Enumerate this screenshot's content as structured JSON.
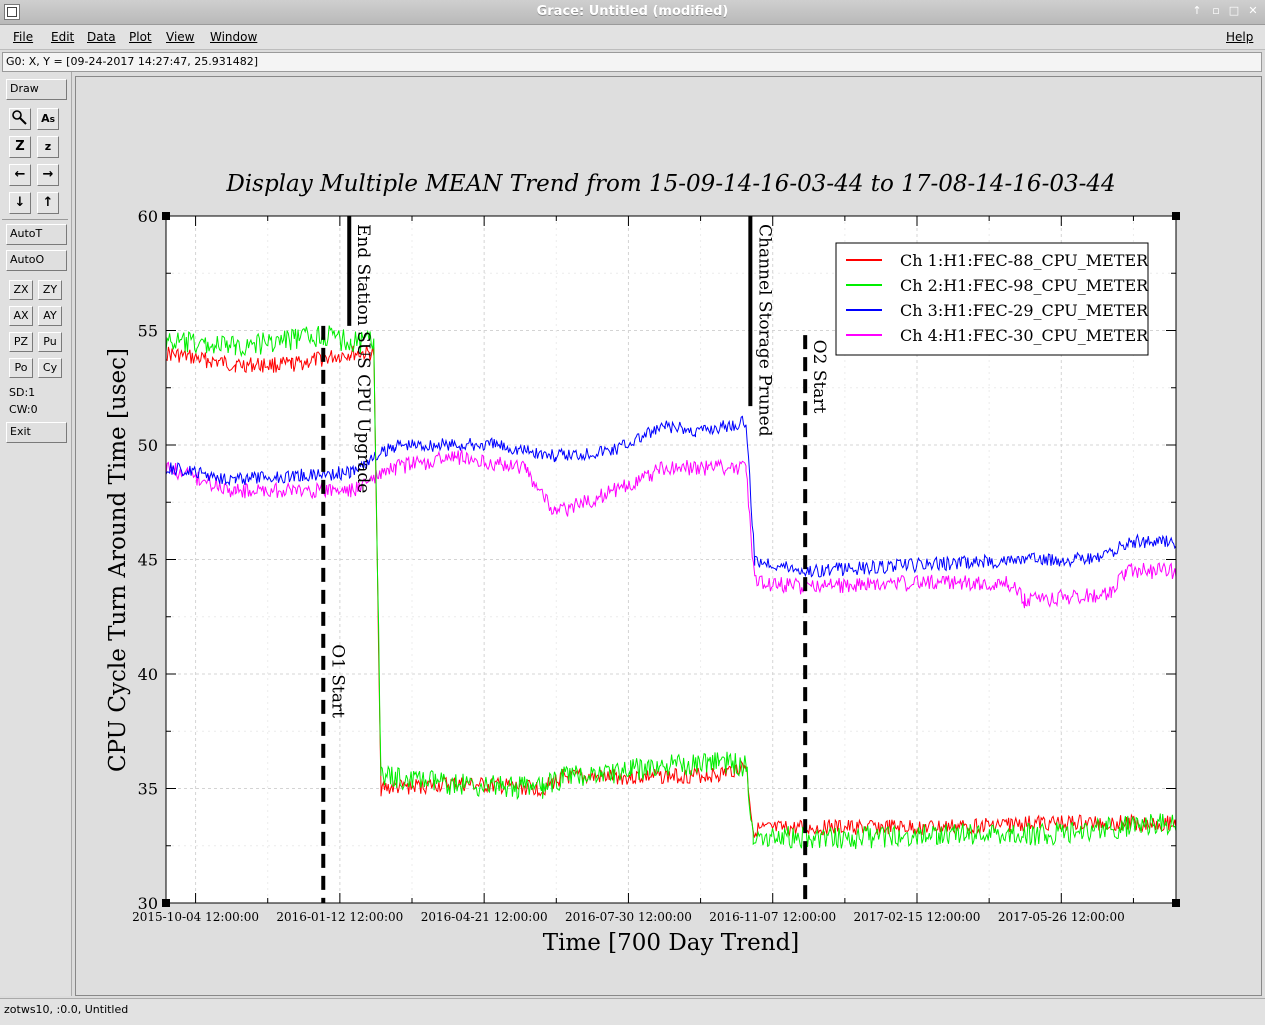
{
  "window": {
    "title": "Grace: Untitled (modified)"
  },
  "menubar": {
    "items": [
      "File",
      "Edit",
      "Data",
      "Plot",
      "View",
      "Window"
    ],
    "help": "Help"
  },
  "locator": {
    "text": "G0: X, Y = [09-24-2017 14:27:47, 25.931482]"
  },
  "tools": {
    "draw": "Draw",
    "autot": "AutoT",
    "autoo": "AutoO",
    "small_buttons": [
      "ZX",
      "ZY",
      "AX",
      "AY",
      "PZ",
      "Pu",
      "Po",
      "Cy"
    ],
    "sd": "SD:1",
    "cw": "CW:0",
    "exit": "Exit"
  },
  "status": {
    "text": "zotws10, :0.0, Untitled"
  },
  "colors": {
    "ch1": "#ff0000",
    "ch2": "#00ee00",
    "ch3": "#0000ff",
    "ch4": "#ff00ff"
  },
  "chart_data": {
    "type": "line",
    "title": "Display Multiple MEAN Trend from 15-09-14-16-03-44 to 17-08-14-16-03-44",
    "xlabel": "Time [700 Day Trend]",
    "ylabel": "CPU Cycle Turn Around Time [usec]",
    "ylim": [
      30,
      60
    ],
    "xlim": [
      "2015-09-14",
      "2017-08-14"
    ],
    "yticks": [
      30,
      35,
      40,
      45,
      50,
      55,
      60
    ],
    "xtick_labels": [
      "2015-10-04 12:00:00",
      "2016-01-12 12:00:00",
      "2016-04-21 12:00:00",
      "2016-07-30 12:00:00",
      "2016-11-07 12:00:00",
      "2017-02-15 12:00:00",
      "2017-05-26 12:00:00"
    ],
    "grid": true,
    "legend_position": "top-right",
    "series": [
      {
        "name": "Ch 1:H1:FEC-88_CPU_METER",
        "x": [
          "2015-09-14",
          "2015-11-01",
          "2015-12-10",
          "2016-01-20",
          "2016-02-05",
          "2016-02-10",
          "2016-04-01",
          "2016-06-01",
          "2016-06-15",
          "2016-08-01",
          "2016-10-01",
          "2016-10-20",
          "2016-10-25",
          "2016-12-15",
          "2017-03-01",
          "2017-05-15",
          "2017-08-14"
        ],
        "values": [
          54.0,
          53.5,
          53.5,
          54.0,
          54.0,
          35.0,
          35.2,
          35.0,
          35.5,
          35.5,
          35.6,
          36.0,
          33.2,
          33.3,
          33.3,
          33.5,
          33.5
        ]
      },
      {
        "name": "Ch 2:H1:FEC-98_CPU_METER",
        "x": [
          "2015-09-14",
          "2015-11-01",
          "2016-01-01",
          "2016-01-20",
          "2016-02-05",
          "2016-02-10",
          "2016-04-01",
          "2016-06-01",
          "2016-06-15",
          "2016-08-01",
          "2016-10-01",
          "2016-10-20",
          "2016-10-25",
          "2016-12-15",
          "2017-03-01",
          "2017-05-15",
          "2017-08-14"
        ],
        "values": [
          54.5,
          54.3,
          54.8,
          54.5,
          54.5,
          35.5,
          35.2,
          35.0,
          35.5,
          35.8,
          36.2,
          36.0,
          33.0,
          32.8,
          33.0,
          33.0,
          33.5
        ]
      },
      {
        "name": "Ch 3:H1:FEC-29_CPU_METER",
        "x": [
          "2015-09-14",
          "2015-11-01",
          "2016-01-20",
          "2016-02-20",
          "2016-05-01",
          "2016-06-10",
          "2016-07-20",
          "2016-08-25",
          "2016-09-15",
          "2016-10-20",
          "2016-10-26",
          "2016-12-01",
          "2017-03-01",
          "2017-05-01",
          "2017-05-26",
          "2017-06-20",
          "2017-07-15",
          "2017-08-14"
        ],
        "values": [
          49.0,
          48.5,
          48.8,
          50.0,
          50.0,
          49.5,
          49.8,
          50.8,
          50.6,
          51.0,
          45.0,
          44.5,
          44.8,
          45.0,
          45.0,
          45.0,
          45.8,
          45.8
        ]
      },
      {
        "name": "Ch 4:H1:FEC-30_CPU_METER",
        "x": [
          "2015-09-14",
          "2015-11-01",
          "2016-01-20",
          "2016-02-20",
          "2016-04-01",
          "2016-05-20",
          "2016-06-10",
          "2016-07-20",
          "2016-08-25",
          "2016-10-20",
          "2016-10-26",
          "2016-12-01",
          "2017-03-01",
          "2017-04-20",
          "2017-05-01",
          "2017-06-30",
          "2017-07-10",
          "2017-08-14"
        ],
        "values": [
          49.0,
          48.0,
          48.0,
          49.0,
          49.5,
          49.0,
          47.0,
          48.0,
          49.0,
          49.0,
          44.0,
          43.8,
          44.0,
          44.0,
          43.2,
          43.5,
          44.5,
          44.5
        ]
      }
    ],
    "events": [
      {
        "date": "2016-01-01",
        "label": "O1 Start",
        "style": "dashed"
      },
      {
        "date": "2016-01-19",
        "label": "End Station SUS CPU Upgrade",
        "style": "solid"
      },
      {
        "date": "2016-10-23",
        "label": "Channel Storage Pruned",
        "style": "solid"
      },
      {
        "date": "2016-11-30",
        "label": "O2 Start",
        "style": "dashed"
      }
    ]
  }
}
